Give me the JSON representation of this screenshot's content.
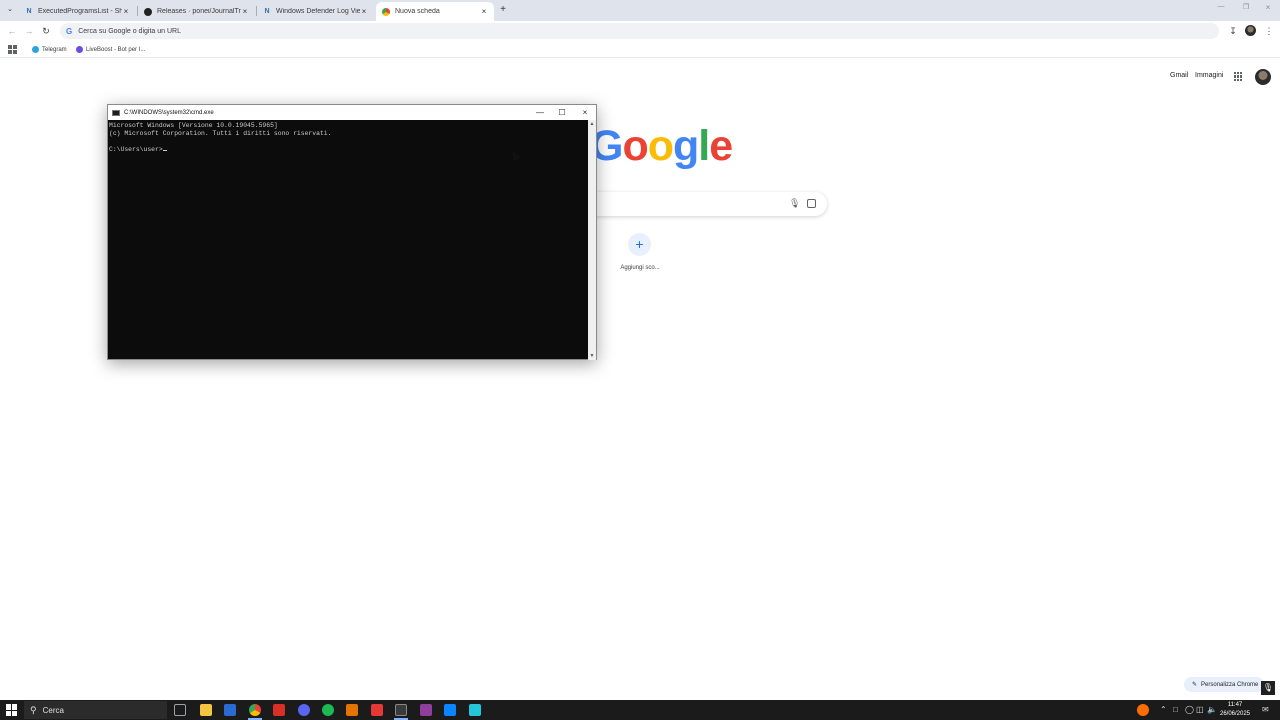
{
  "browser": {
    "tabs": [
      {
        "title": "ExecutedProgramsList - Shows",
        "icon": "nirsoft-icon"
      },
      {
        "title": "Releases · ponei/JournalTrace",
        "icon": "github-icon"
      },
      {
        "title": "Windows Defender Log Viewer",
        "icon": "nirsoft-icon"
      },
      {
        "title": "Nuova scheda",
        "icon": "chrome-icon"
      }
    ],
    "new_tab_symbol": "+",
    "omnibox_placeholder": "Cerca su Google o digita un URL",
    "bookmarks": [
      {
        "label": "Telegram",
        "color": "#2aa3df"
      },
      {
        "label": "LiveBoost - Bot per I...",
        "color": "#6b4ce6"
      }
    ]
  },
  "ntp": {
    "gmail": "Gmail",
    "images": "Immagini",
    "logo_letters": [
      "G",
      "o",
      "o",
      "g",
      "l",
      "e"
    ],
    "logo_colors": [
      "#4285f4",
      "#ea4335",
      "#fbbc05",
      "#4285f4",
      "#34a853",
      "#ea4335"
    ],
    "add_shortcut_symbol": "+",
    "add_shortcut_label": "Aggiungi sco...",
    "customize_label": "Personalizza Chrome"
  },
  "cmd": {
    "title": "C:\\WINDOWS\\system32\\cmd.exe",
    "lines": [
      "Microsoft Windows [Versione 10.0.19045.5965]",
      "(c) Microsoft Corporation. Tutti i diritti sono riservati.",
      "",
      "C:\\Users\\user>"
    ]
  },
  "taskbar": {
    "search_label": "Cerca",
    "time": "11:47",
    "date": "26/06/2025",
    "apps": [
      {
        "name": "task-view-icon",
        "color": "#9aa0a6"
      },
      {
        "name": "file-explorer-icon",
        "color": "#f4c542"
      },
      {
        "name": "app-icon-blue",
        "color": "#2a6bd1"
      },
      {
        "name": "chrome-taskbar-icon",
        "color": "#34a853"
      },
      {
        "name": "app-icon-red",
        "color": "#d93025"
      },
      {
        "name": "discord-icon",
        "color": "#5865f2"
      },
      {
        "name": "spotify-icon",
        "color": "#1db954"
      },
      {
        "name": "app-icon-orange",
        "color": "#e37400"
      },
      {
        "name": "app-icon-red-2",
        "color": "#e53935"
      },
      {
        "name": "cmd-taskbar-icon",
        "color": "#3a3a3a"
      },
      {
        "name": "winrar-icon",
        "color": "#8e3e9c"
      },
      {
        "name": "app-icon-blue-2",
        "color": "#0a84ff"
      },
      {
        "name": "app-icon-teal",
        "color": "#26c6da"
      }
    ]
  }
}
